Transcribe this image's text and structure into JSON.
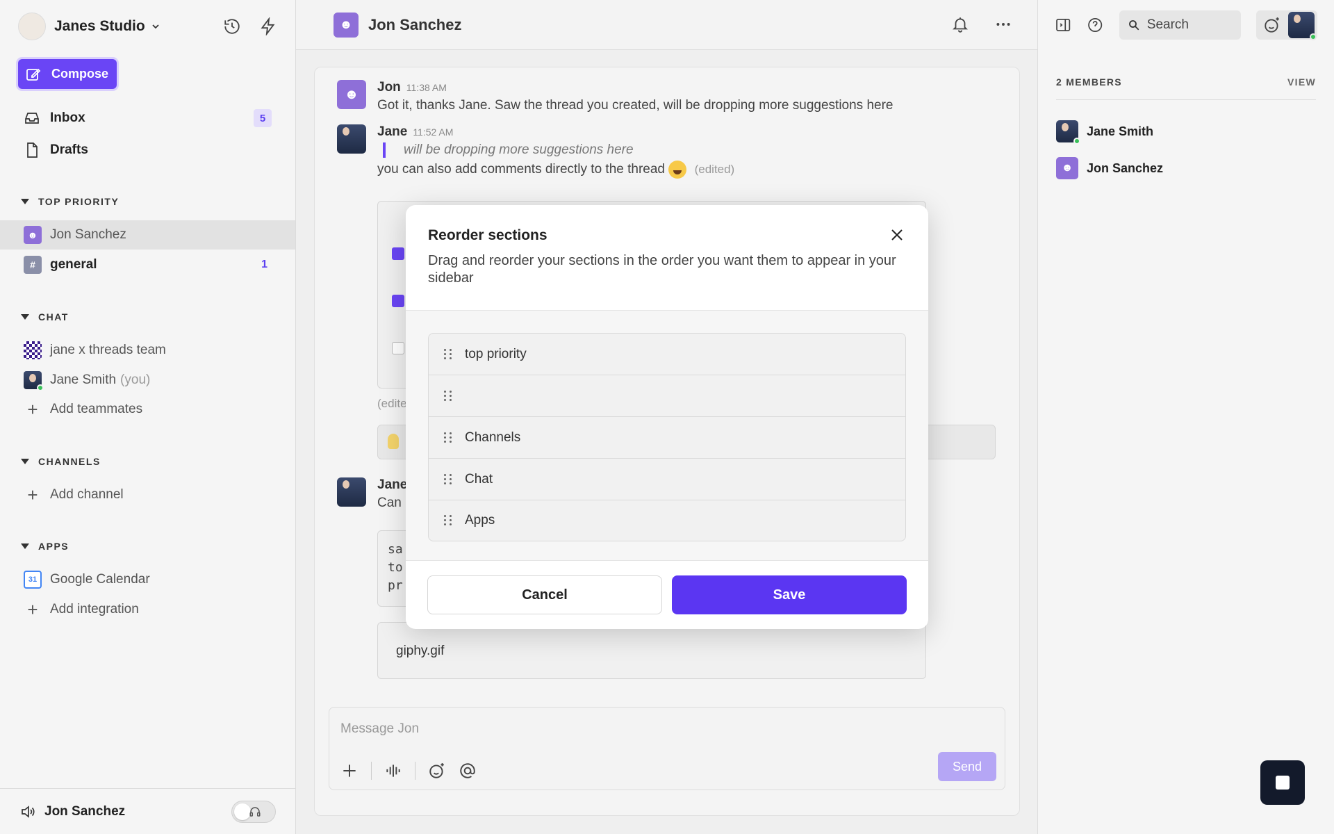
{
  "workspace": {
    "name": "Janes Studio",
    "logo_text": "JANES STUDIO"
  },
  "sidebar": {
    "compose_label": "Compose",
    "nav": [
      {
        "label": "Inbox",
        "badge": "5"
      },
      {
        "label": "Drafts"
      }
    ],
    "sections": {
      "top_priority": {
        "title": "TOP PRIORITY",
        "items": [
          {
            "label": "Jon Sanchez"
          },
          {
            "label": "general",
            "count": "1",
            "icon_text": "#"
          }
        ]
      },
      "chat": {
        "title": "CHAT",
        "items": [
          {
            "label": "jane x threads team"
          },
          {
            "label": "Jane Smith",
            "suffix": "(you)"
          }
        ],
        "add_label": "Add teammates"
      },
      "channels": {
        "title": "CHANNELS",
        "add_label": "Add channel"
      },
      "apps": {
        "title": "APPS",
        "items": [
          {
            "label": "Google Calendar",
            "icon_text": "31"
          }
        ],
        "add_label": "Add integration"
      }
    },
    "footer": {
      "label": "Jon Sanchez"
    }
  },
  "conversation": {
    "title": "Jon Sanchez",
    "messages": [
      {
        "author": "Jon",
        "time": "11:38 AM",
        "text": "Got it, thanks Jane. Saw the thread you created, will be dropping more suggestions here"
      },
      {
        "author": "Jane",
        "time": "11:52 AM",
        "quote": "will be dropping more suggestions here",
        "text": "you can also add comments directly to the thread",
        "edited": "(edited)"
      },
      {
        "author": "Jane",
        "partial_text": "Can"
      }
    ],
    "partial_edited": "(edite",
    "code_fragments": [
      "sa",
      "to",
      "pr"
    ],
    "attachment_name": "giphy.gif",
    "composer": {
      "placeholder": "Message Jon",
      "send_label": "Send"
    }
  },
  "right_panel": {
    "search_placeholder": "Search",
    "members_heading": "2 MEMBERS",
    "view_label": "VIEW",
    "members": [
      {
        "name": "Jane Smith"
      },
      {
        "name": "Jon Sanchez"
      }
    ]
  },
  "modal": {
    "title": "Reorder sections",
    "subtitle": "Drag and reorder your sections in the order you want them to appear in your sidebar",
    "sections": [
      {
        "label": "top priority"
      },
      {
        "label": ""
      },
      {
        "label": "Channels"
      },
      {
        "label": "Chat"
      },
      {
        "label": "Apps"
      }
    ],
    "cancel_label": "Cancel",
    "save_label": "Save"
  },
  "colors": {
    "accent": "#6a45f5",
    "save_button": "#5b36f2",
    "online": "#3ac05a",
    "send_disabled": "#b5a6f5"
  },
  "icons": [
    "history-icon",
    "lightning-icon",
    "compose-icon",
    "inbox-icon",
    "drafts-icon",
    "bell-icon",
    "more-icon",
    "panel-toggle-icon",
    "help-icon",
    "search-icon",
    "emoji-add-icon",
    "plus-icon",
    "audio-icon",
    "emoji-icon",
    "mention-icon",
    "speaker-icon",
    "headphones-icon",
    "close-icon",
    "drag-handle-icon",
    "stop-icon"
  ]
}
